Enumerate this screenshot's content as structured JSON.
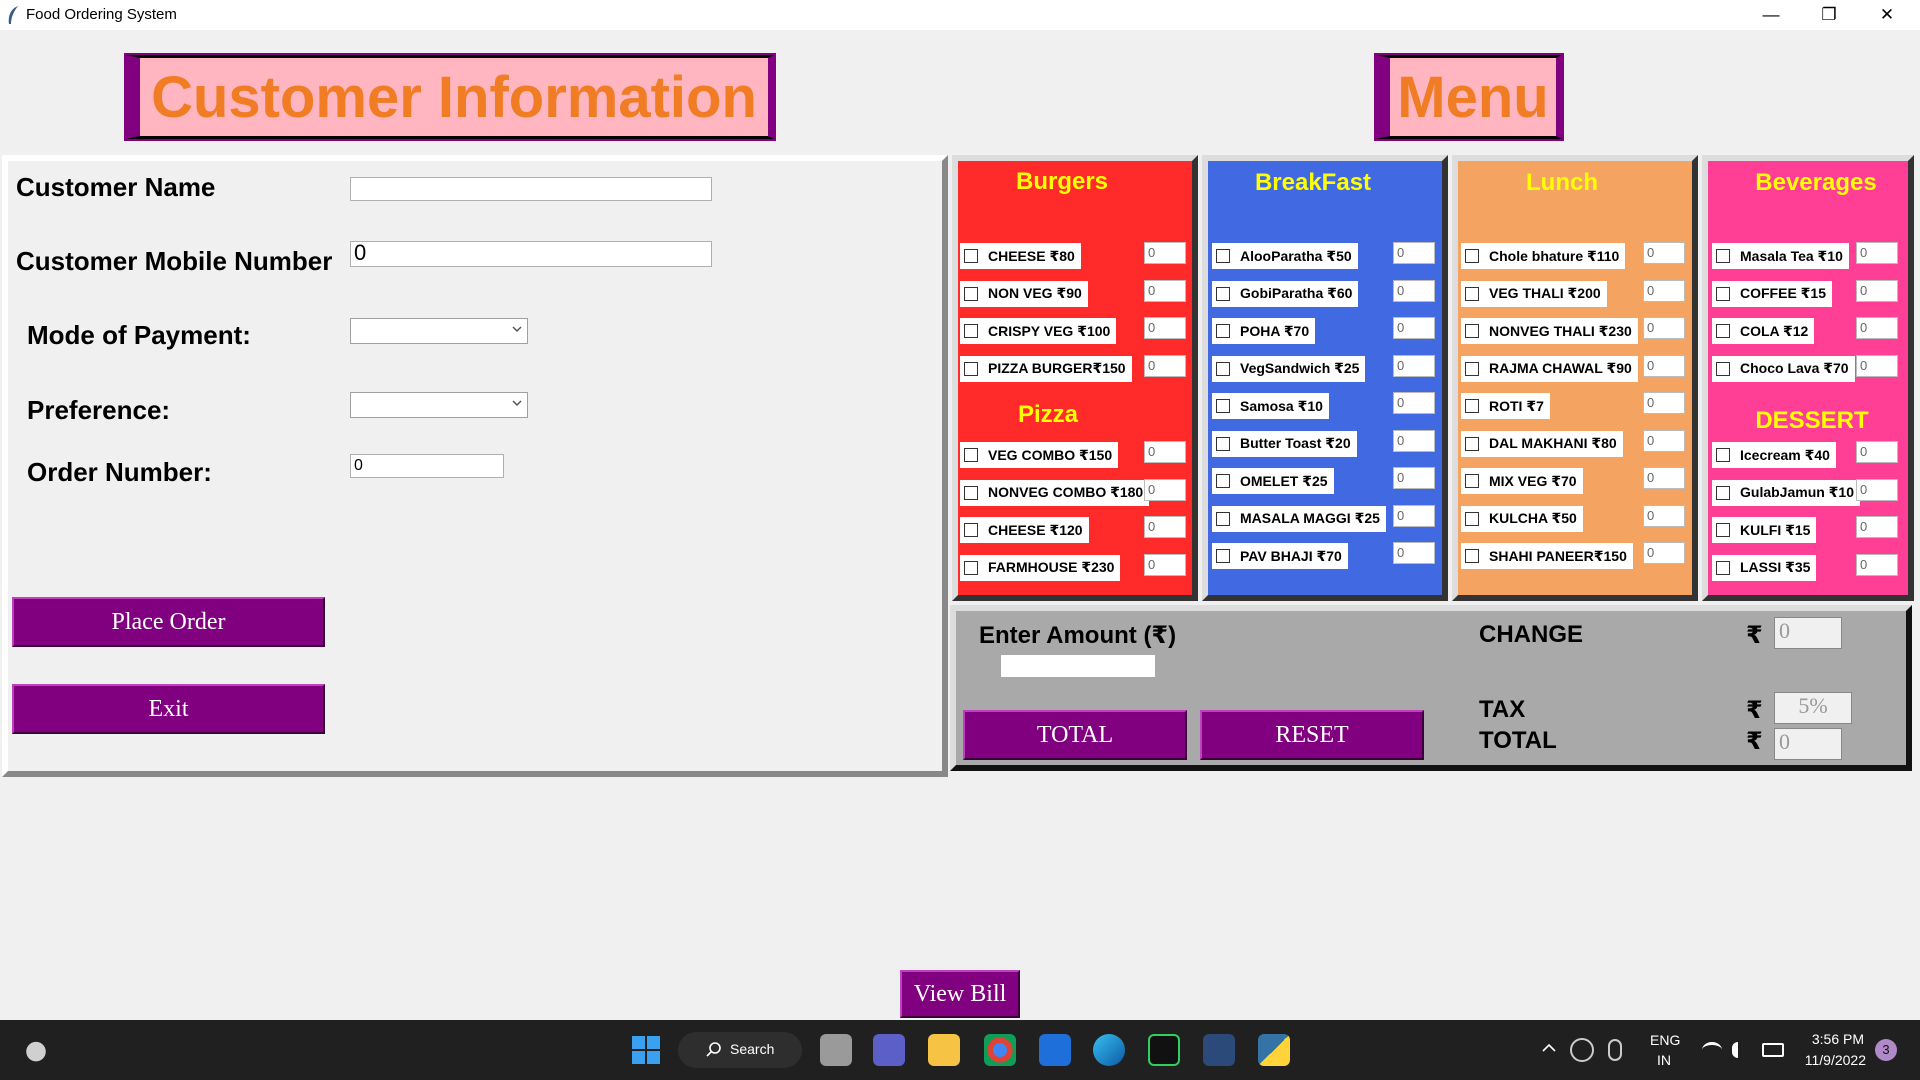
{
  "window": {
    "title": "Food Ordering System",
    "minimize": "—",
    "restore": "❐",
    "close": "✕"
  },
  "headers": {
    "customer": "Customer Information",
    "menu": "Menu"
  },
  "customer": {
    "name_label": "Customer Name",
    "name_value": "",
    "mobile_label": "Customer Mobile Number",
    "mobile_value": "0",
    "payment_label": "Mode of Payment:",
    "payment_value": "",
    "preference_label": "Preference:",
    "preference_value": "",
    "order_label": "Order Number:",
    "order_value": "0",
    "place_order": "Place Order",
    "exit": "Exit"
  },
  "menu": {
    "burgers": {
      "title": "Burgers",
      "items": [
        {
          "label": "CHEESE  ₹80",
          "qty": "0"
        },
        {
          "label": "NON VEG ₹90",
          "qty": "0"
        },
        {
          "label": "CRISPY VEG ₹100",
          "qty": "0"
        },
        {
          "label": "PIZZA BURGER₹150",
          "qty": "0"
        }
      ]
    },
    "pizza": {
      "title": "Pizza",
      "items": [
        {
          "label": "VEG COMBO ₹150",
          "qty": "0"
        },
        {
          "label": "NONVEG COMBO ₹180",
          "qty": "0"
        },
        {
          "label": "CHEESE  ₹120",
          "qty": "0"
        },
        {
          "label": "FARMHOUSE  ₹230",
          "qty": "0"
        }
      ]
    },
    "breakfast": {
      "title": "BreakFast",
      "items": [
        {
          "label": "AlooParatha   ₹50",
          "qty": "0"
        },
        {
          "label": "GobiParatha   ₹60",
          "qty": "0"
        },
        {
          "label": "POHA     ₹70",
          "qty": "0"
        },
        {
          "label": "VegSandwich   ₹25",
          "qty": "0"
        },
        {
          "label": "Samosa   ₹10",
          "qty": "0"
        },
        {
          "label": "Butter Toast  ₹20",
          "qty": "0"
        },
        {
          "label": "OMELET     ₹25",
          "qty": "0"
        },
        {
          "label": "MASALA MAGGI  ₹25",
          "qty": "0"
        },
        {
          "label": "PAV BHAJI   ₹70",
          "qty": "0"
        }
      ]
    },
    "lunch": {
      "title": "Lunch",
      "items": [
        {
          "label": "Chole bhature ₹110",
          "qty": "0"
        },
        {
          "label": "VEG THALI ₹200",
          "qty": "0"
        },
        {
          "label": "NONVEG THALI ₹230",
          "qty": "0"
        },
        {
          "label": "RAJMA CHAWAL ₹90",
          "qty": "0"
        },
        {
          "label": "ROTI ₹7",
          "qty": "0"
        },
        {
          "label": "DAL MAKHANI ₹80",
          "qty": "0"
        },
        {
          "label": "MIX VEG ₹70",
          "qty": "0"
        },
        {
          "label": "KULCHA ₹50",
          "qty": "0"
        },
        {
          "label": "SHAHI PANEER₹150",
          "qty": "0"
        }
      ]
    },
    "beverages": {
      "title": "Beverages",
      "items": [
        {
          "label": "Masala Tea ₹10",
          "qty": "0"
        },
        {
          "label": "COFFEE ₹15",
          "qty": "0"
        },
        {
          "label": "COLA ₹12",
          "qty": "0"
        },
        {
          "label": "Choco Lava ₹70",
          "qty": "0"
        }
      ]
    },
    "dessert": {
      "title": "DESSERT",
      "items": [
        {
          "label": "Icecream ₹40",
          "qty": "0"
        },
        {
          "label": "GulabJamun ₹10",
          "qty": "0"
        },
        {
          "label": "KULFI ₹15",
          "qty": "0"
        },
        {
          "label": "LASSI ₹35",
          "qty": "0"
        }
      ]
    }
  },
  "bill": {
    "amount_label": "Enter Amount (₹)",
    "amount_value": "",
    "change_label": "CHANGE",
    "change_value": "0",
    "tax_label": "TAX",
    "tax_value": "5%",
    "total_label": "TOTAL",
    "total_value": "0",
    "rupee": "₹",
    "total_button": "TOTAL",
    "reset_button": "RESET"
  },
  "view_bill": "View Bill",
  "taskbar": {
    "search": "Search",
    "lang_top": "ENG",
    "lang_bottom": "IN",
    "time": "3:56 PM",
    "date": "11/9/2022",
    "notifications": "3"
  },
  "colors": {
    "purple": "#800080",
    "burgers_bg": "#ff2a2a",
    "breakfast_bg": "#4169e1",
    "lunch_bg": "#f4a460",
    "beverages_bg": "#ff3e96",
    "header_pink": "#ffb6c1",
    "header_text": "#f07c24",
    "category_title": "#ffff00"
  }
}
